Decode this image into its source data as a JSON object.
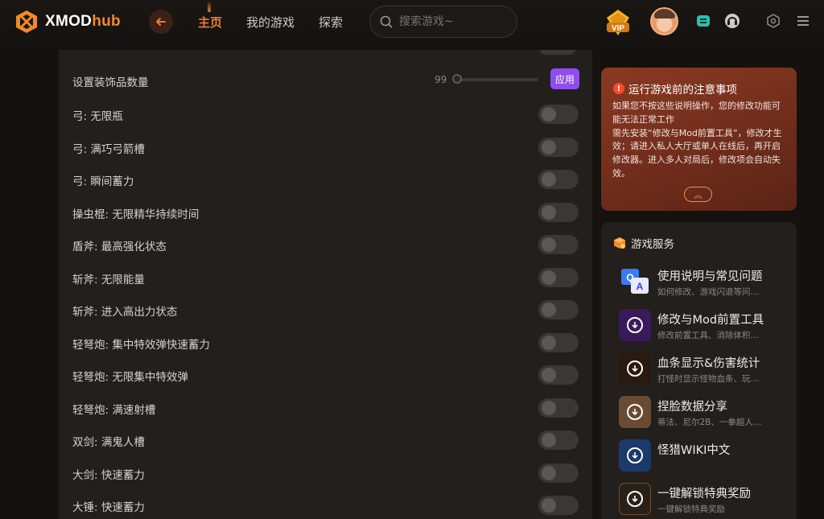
{
  "brand": {
    "name_a": "XMOD",
    "name_b": "hub"
  },
  "nav": {
    "items": [
      "主页",
      "我的游戏",
      "探索"
    ]
  },
  "search": {
    "placeholder": "搜索游戏~"
  },
  "vip": {
    "label": "VIP"
  },
  "settings_rows": {
    "decor": {
      "label": "设置装饰品数量",
      "value": "99",
      "button": "应用"
    },
    "toggles": [
      {
        "label": "弓: 无限瓶"
      },
      {
        "label": "弓: 满巧弓箭槽"
      },
      {
        "label": "弓: 瞬间蓄力"
      },
      {
        "label": "操虫棍: 无限精华持续时间"
      },
      {
        "label": "盾斧: 最高强化状态"
      },
      {
        "label": "斩斧: 无限能量"
      },
      {
        "label": "斩斧: 进入高出力状态"
      },
      {
        "label": "轻弩炮: 集中特效弹快速蓄力"
      },
      {
        "label": "轻弩炮: 无限集中特效弹"
      },
      {
        "label": "轻弩炮: 满速射槽"
      },
      {
        "label": "双剑: 满鬼人槽"
      },
      {
        "label": "大剑: 快速蓄力"
      },
      {
        "label": "大锤: 快速蓄力"
      }
    ]
  },
  "notice": {
    "title": "运行游戏前的注意事项",
    "line1": "如果您不按这些说明操作，您的修改功能可能无法正常工作",
    "line2": "需先安装“修改与Mod前置工具”，修改才生效；请进入私人大厅或单人在线后，再开启修改器。进入多人对局后，修改项会自动失效。",
    "collapse": "︽"
  },
  "services": {
    "title": "游戏服务",
    "items": [
      {
        "title": "使用说明与常见问题",
        "sub": "如何修改、游戏闪退等问…",
        "icon": "qa-icon"
      },
      {
        "title": "修改与Mod前置工具",
        "sub": "修改前置工具、消除体积…",
        "icon": "download-icon"
      },
      {
        "title": "血条显示&伤害统计",
        "sub": "打怪时显示怪物血条、玩…",
        "icon": "download-icon"
      },
      {
        "title": "捏脸数据分享",
        "sub": "蒂法、尼尔2B、一拳超人…",
        "icon": "download-icon"
      },
      {
        "title": "怪猎WIKI中文",
        "sub": "",
        "icon": "download-icon"
      },
      {
        "title": "一键解锁特典奖励",
        "sub": "一键解锁特典奖励",
        "icon": "download-icon"
      }
    ]
  }
}
